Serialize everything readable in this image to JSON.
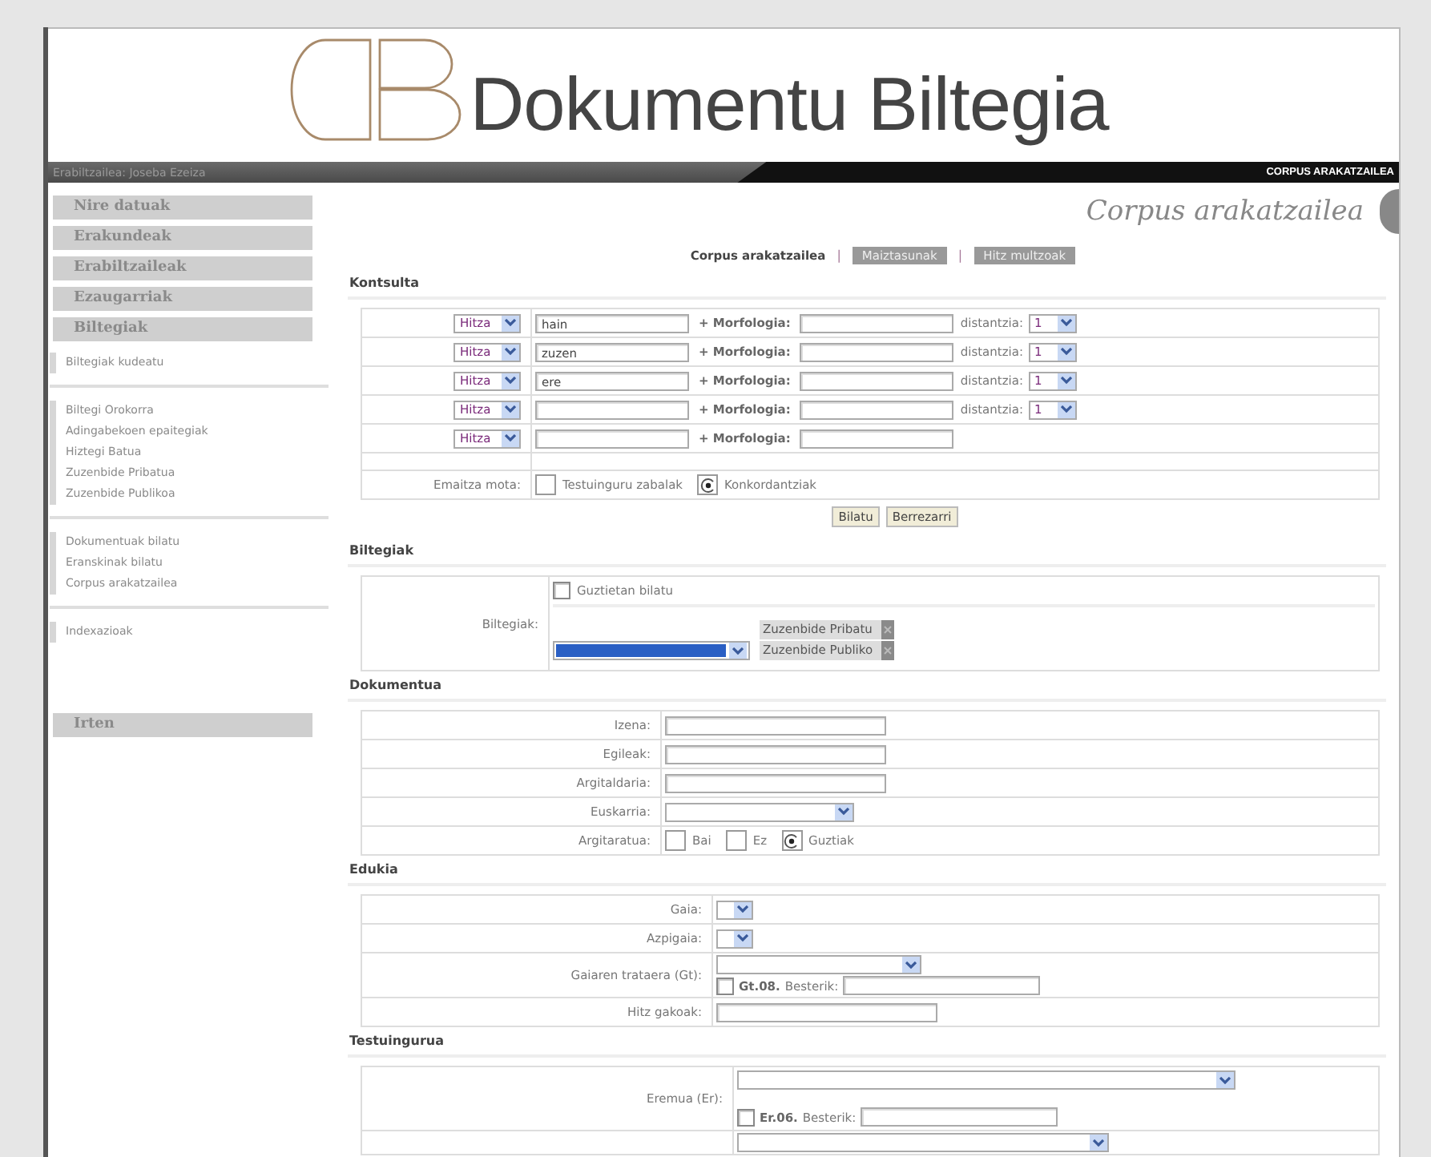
{
  "header": {
    "title": "Dokumentu Biltegia"
  },
  "user_bar": {
    "user": "Erabiltzailea: Joseba Ezeiza",
    "section": "CORPUS ARAKATZAILEA"
  },
  "sidebar": [
    {
      "kind": "heading",
      "label": "Nire datuak"
    },
    {
      "kind": "heading",
      "label": "Erakundeak"
    },
    {
      "kind": "heading",
      "label": "Erabiltzaileak"
    },
    {
      "kind": "heading",
      "label": "Ezaugarriak"
    },
    {
      "kind": "heading",
      "label": "Biltegiak"
    },
    {
      "kind": "links",
      "items": [
        "Biltegiak kudeatu"
      ]
    },
    {
      "kind": "links",
      "items": [
        "Biltegi Orokorra",
        "Adingabekoen epaitegiak",
        "Hiztegi Batua",
        "Zuzenbide Pribatua",
        "Zuzenbide Publikoa"
      ]
    },
    {
      "kind": "links",
      "items": [
        "Dokumentuak bilatu",
        "Eranskinak bilatu",
        "Corpus arakatzailea"
      ]
    },
    {
      "kind": "links",
      "items": [
        "Indexazioak"
      ]
    },
    {
      "kind": "exit",
      "label": "Irten"
    }
  ],
  "page_title": "Corpus arakatzailea",
  "subnav": {
    "items": [
      {
        "label": "Corpus arakatzailea",
        "selected": true
      },
      {
        "label": "Maiztasunak",
        "selected": false
      },
      {
        "label": "Hitz multzoak",
        "selected": false
      }
    ],
    "separators": [
      "|",
      "|"
    ]
  },
  "query": {
    "title": "Kontsulta",
    "rows": [
      {
        "type": "Hitza",
        "word": "hain",
        "morph_label": "+ Morfologia:",
        "distance_label": "distantzia:",
        "distance": "1"
      },
      {
        "type": "Hitza",
        "word": "zuzen",
        "morph_label": "+ Morfologia:",
        "distance_label": "distantzia:",
        "distance": "1"
      },
      {
        "type": "Hitza",
        "word": "ere",
        "morph_label": "+ Morfologia:",
        "distance_label": "distantzia:",
        "distance": "1"
      },
      {
        "type": "Hitza",
        "morph_label": "+ Morfologia:",
        "distance_label": "distantzia:",
        "distance": "1"
      },
      {
        "type": "Hitza",
        "morph_label": "+ Morfologia:"
      }
    ],
    "result_label": "Emaitza mota:",
    "result_options": [
      {
        "label": "Testuinguru zabalak",
        "selected": false
      },
      {
        "label": "Konkordantziak",
        "selected": true
      }
    ],
    "buttons": [
      "Bilatu",
      "Berrezarri"
    ]
  },
  "repositories": {
    "title": "Biltegiak",
    "label": "Biltegiak:",
    "all": {
      "label": "Guztietan bilatu",
      "checked": false
    },
    "select": {
      "highlighted": true
    },
    "chosen": [
      "Zuzenbide Pribatu",
      "Zuzenbide Publiko"
    ]
  },
  "document": {
    "title": "Dokumentua",
    "rows": [
      {
        "kind": "text",
        "label": "Izena:"
      },
      {
        "kind": "text",
        "label": "Egileak:"
      },
      {
        "kind": "text",
        "label": "Argitaldaria:"
      },
      {
        "kind": "select",
        "label": "Euskarria:"
      },
      {
        "kind": "radios",
        "label": "Argitaratua:",
        "options": [
          {
            "label": "Bai",
            "selected": false
          },
          {
            "label": "Ez",
            "selected": false
          },
          {
            "label": "Guztiak",
            "selected": true
          }
        ]
      }
    ]
  },
  "content": {
    "title": "Edukia",
    "rows": [
      {
        "kind": "select_small",
        "label": "Gaia:"
      },
      {
        "kind": "select_small",
        "label": "Azpigaia:"
      },
      {
        "kind": "select_other",
        "label": "Gaiaren trataera (Gt):",
        "code": "Gt.08.",
        "other_label": "Besterik:",
        "checked": false
      },
      {
        "kind": "text",
        "label": "Hitz gakoak:"
      }
    ]
  },
  "context": {
    "title": "Testuingurua",
    "rows": [
      {
        "kind": "select_other_wide",
        "label": "Eremua (Er):",
        "code": "Er.06.",
        "other_label": "Besterik:",
        "checked": false
      },
      {
        "kind": "select_cut"
      }
    ]
  }
}
